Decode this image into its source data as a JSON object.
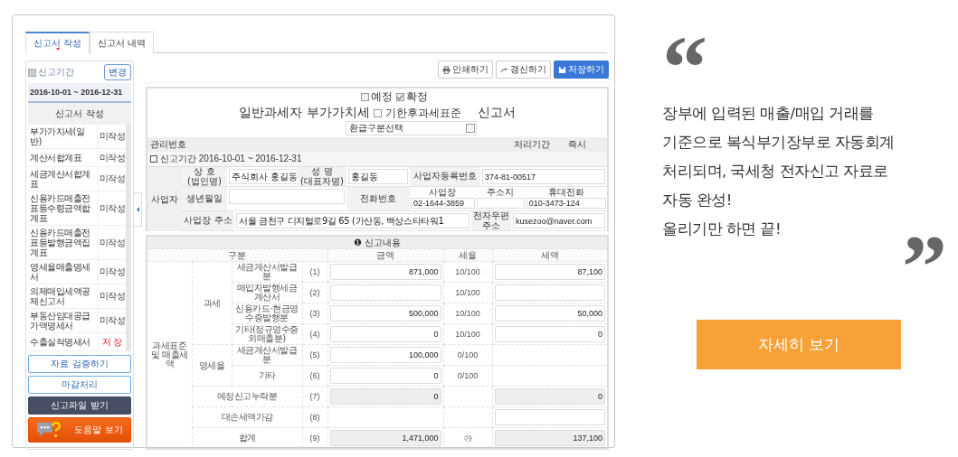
{
  "tabs": [
    {
      "label": "신고서 작성",
      "selected": true
    },
    {
      "label": "신고서 내역",
      "selected": false
    }
  ],
  "sidebar": {
    "period_label": "신고기간",
    "change_button": "변경",
    "period": "2016-10-01 ~ 2016-12-31",
    "list_title": "신고서 작성",
    "items": [
      {
        "name": "부가가치세(일반)",
        "status": "미작성",
        "saved": false
      },
      {
        "name": "계산서합계표",
        "status": "미작성",
        "saved": false
      },
      {
        "name": "세금계산서합계표",
        "status": "미작성",
        "saved": false
      },
      {
        "name": "신용카드매출전표등수령금액합계표",
        "status": "미작성",
        "saved": false
      },
      {
        "name": "신용카드매출전표등발행금액집계표",
        "status": "미작성",
        "saved": false
      },
      {
        "name": "영세율매출명세서",
        "status": "미작성",
        "saved": false
      },
      {
        "name": "의제매입세액공제신고서",
        "status": "미작성",
        "saved": false
      },
      {
        "name": "부동산임대공급가액명세서",
        "status": "미작성",
        "saved": false
      },
      {
        "name": "수출실적명세서",
        "status": "저 장",
        "saved": true
      }
    ],
    "buttons": [
      {
        "label": "자료 검증하기",
        "kind": "outline"
      },
      {
        "label": "마감처리",
        "kind": "outline"
      },
      {
        "label": "신고파일 받기",
        "kind": "dark"
      },
      {
        "label": "도움말 보기",
        "kind": "help"
      }
    ]
  },
  "toolbar": [
    {
      "label": "인쇄하기",
      "primary": false
    },
    {
      "label": "갱신하기",
      "primary": false
    },
    {
      "label": "저장하기",
      "primary": true
    }
  ],
  "form": {
    "options": [
      {
        "label": "예정",
        "checked": false
      },
      {
        "label": "확정",
        "checked": true
      }
    ],
    "title_start": "일반과세자 부가가치세",
    "late_option": {
      "label": "기한후과세표준",
      "checked": false
    },
    "title_end": "신고서",
    "refund_select": {
      "value": "환급구분선택"
    },
    "management_label": "관리번호",
    "processing_label": "처리기간",
    "processing_value": "즉시",
    "period": "신고기간 2016-10-01 ~ 2016-12-31"
  },
  "business": {
    "title": "사업자",
    "trade_name_label": "상 호\n(법인명)",
    "trade_name": "주식회사 홍길동",
    "rep_label": "성 명\n(대표자명)",
    "rep_name": "홍길동",
    "reg_no_label": "사업자등록번호",
    "reg_no": "374-81-00517",
    "birth_label": "생년월일",
    "phone_label": "전화번호",
    "phones": [
      {
        "label": "사업장",
        "value": "02-1644-3859"
      },
      {
        "label": "주소지"
      },
      {
        "label": "휴대전화",
        "value": "010-3473-124"
      }
    ],
    "address_label": "사업장 주소",
    "address": "서울 금천구 디지털로9길 65 (가산동, 백상스타타워1",
    "email_label": "전자우편 주소",
    "email": "kusezoo@naver.com"
  },
  "report": {
    "mark": "❶",
    "title": "신고내용",
    "headers": [
      "구분",
      "금액",
      "세율",
      "세액"
    ],
    "section": "과세표준 및 매출세액",
    "groups": [
      {
        "label": "과세",
        "rows": [
          {
            "label": "세금계산서발급분",
            "no": "(1)",
            "amount": {
              "value": "871,000",
              "readonly": false
            },
            "rate": "10/100",
            "tax": {
              "value": "87,100",
              "readonly": false
            }
          },
          {
            "label": "매입자발행세금계산서",
            "no": "(2)",
            "amount": {
              "readonly": false
            },
            "rate": "10/100",
            "tax": {
              "readonly": false
            }
          },
          {
            "label": "신용카드·현금영수증발행분",
            "no": "(3)",
            "amount": {
              "value": "500,000",
              "readonly": false
            },
            "rate": "10/100",
            "tax": {
              "value": "50,000",
              "readonly": false
            }
          },
          {
            "label": "기타(정규영수증외매출분)",
            "no": "(4)",
            "amount": {
              "value": "0",
              "readonly": false
            },
            "rate": "10/100",
            "tax": {
              "value": "0",
              "readonly": false
            }
          }
        ]
      },
      {
        "label": "영세율",
        "rows": [
          {
            "label": "세금계산서발급분",
            "no": "(5)",
            "amount": {
              "value": "100,000",
              "readonly": false
            },
            "rate": "0/100"
          },
          {
            "label": "기타",
            "no": "(6)",
            "amount": {
              "value": "0",
              "readonly": false
            },
            "rate": "0/100"
          }
        ]
      }
    ],
    "totals": [
      {
        "label": "예정신고누락분",
        "no": "(7)",
        "amount": {
          "value": "0",
          "readonly": true
        },
        "tax": {
          "value": "0",
          "readonly": true
        }
      },
      {
        "label": "대손세액가감",
        "no": "(8)",
        "tax": {
          "readonly": false
        }
      },
      {
        "label": "합계",
        "no": "(9)",
        "amount": {
          "value": "1,471,000",
          "readonly": true
        },
        "rate": "㉮",
        "tax": {
          "value": "137,100",
          "readonly": true
        }
      }
    ]
  },
  "promo": {
    "open_quote": "“",
    "text": "장부에 입력된 매출/매입 거래를\n기준으로 복식부기장부로 자동회계\n처리되며, 국세청 전자신고 자료로\n자동 완성!\n올리기만 하면 끝!",
    "close_quote": "”",
    "button": "자세히 보기"
  }
}
